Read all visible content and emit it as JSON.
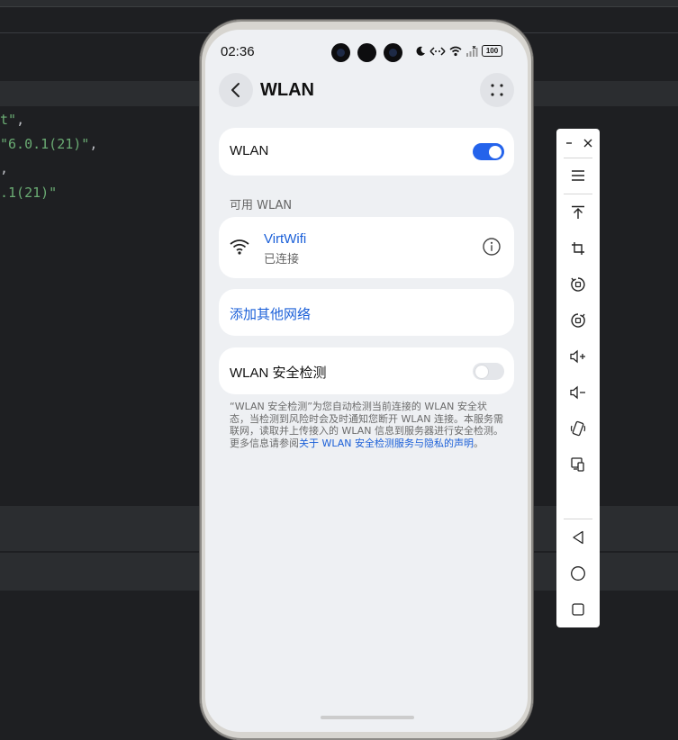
{
  "editor": {
    "lines": [
      {
        "text": "t\"",
        "punc": ","
      },
      {
        "text": "\"6.0.1(21)\"",
        "punc": ","
      },
      {
        "text": "",
        "punc": ","
      },
      {
        "text": ".1(21)\"",
        "punc": ""
      }
    ]
  },
  "phone": {
    "status_bar": {
      "time": "02:36",
      "battery": "100"
    },
    "nav": {
      "title": "WLAN"
    },
    "wlan_toggle": {
      "label": "WLAN",
      "state": "on"
    },
    "available_section": {
      "heading": "可用 WLAN"
    },
    "network": {
      "name": "VirtWifi",
      "status": "已连接"
    },
    "add_network": {
      "label": "添加其他网络"
    },
    "security_check": {
      "label": "WLAN 安全检测",
      "state": "off",
      "description": "“WLAN 安全检测”为您自动检测当前连接的 WLAN 安全状态，当检测到风险时会及时通知您断开 WLAN 连接。本服务需联网，读取并上传接入的 WLAN 信息到服务器进行安全检测。更多信息请参阅",
      "link_text": "关于 WLAN 安全检测服务与隐私的声明",
      "suffix": "。"
    }
  },
  "toolbar": {
    "buttons": [
      "menu-icon",
      "upload-top-icon",
      "crop-icon",
      "rotate-left-icon",
      "rotate-right-icon",
      "volume-up-icon",
      "volume-down-icon",
      "shake-icon",
      "screen-cast-icon",
      "back-icon",
      "home-icon",
      "recents-icon"
    ]
  }
}
